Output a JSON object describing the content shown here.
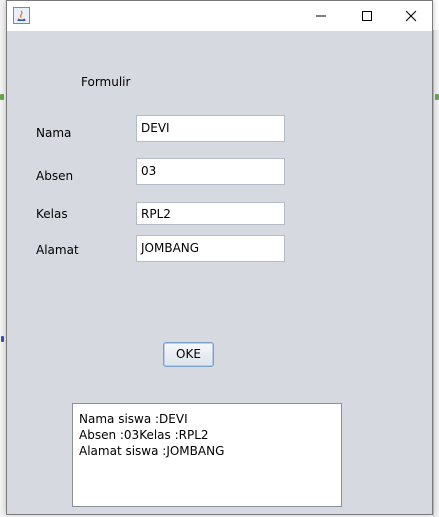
{
  "window": {
    "title": "",
    "buttons": {
      "minimize": "minimize-icon",
      "maximize": "maximize-icon",
      "close": "close-icon"
    }
  },
  "form": {
    "heading": "Formulir",
    "fields": [
      {
        "label": "Nama",
        "value": "DEVI"
      },
      {
        "label": "Absen",
        "value": "03"
      },
      {
        "label": "Kelas",
        "value": "RPL2"
      },
      {
        "label": "Alamat",
        "value": "JOMBANG"
      }
    ],
    "submit_label": "OKE"
  },
  "output": {
    "lines": [
      "Nama siswa :DEVI",
      "Absen :03Kelas :RPL2",
      "Alamat siswa :JOMBANG"
    ]
  },
  "colors": {
    "window_background": "#d6d9df",
    "titlebar": "#ffffff",
    "button_border": "#7aa0c9"
  }
}
